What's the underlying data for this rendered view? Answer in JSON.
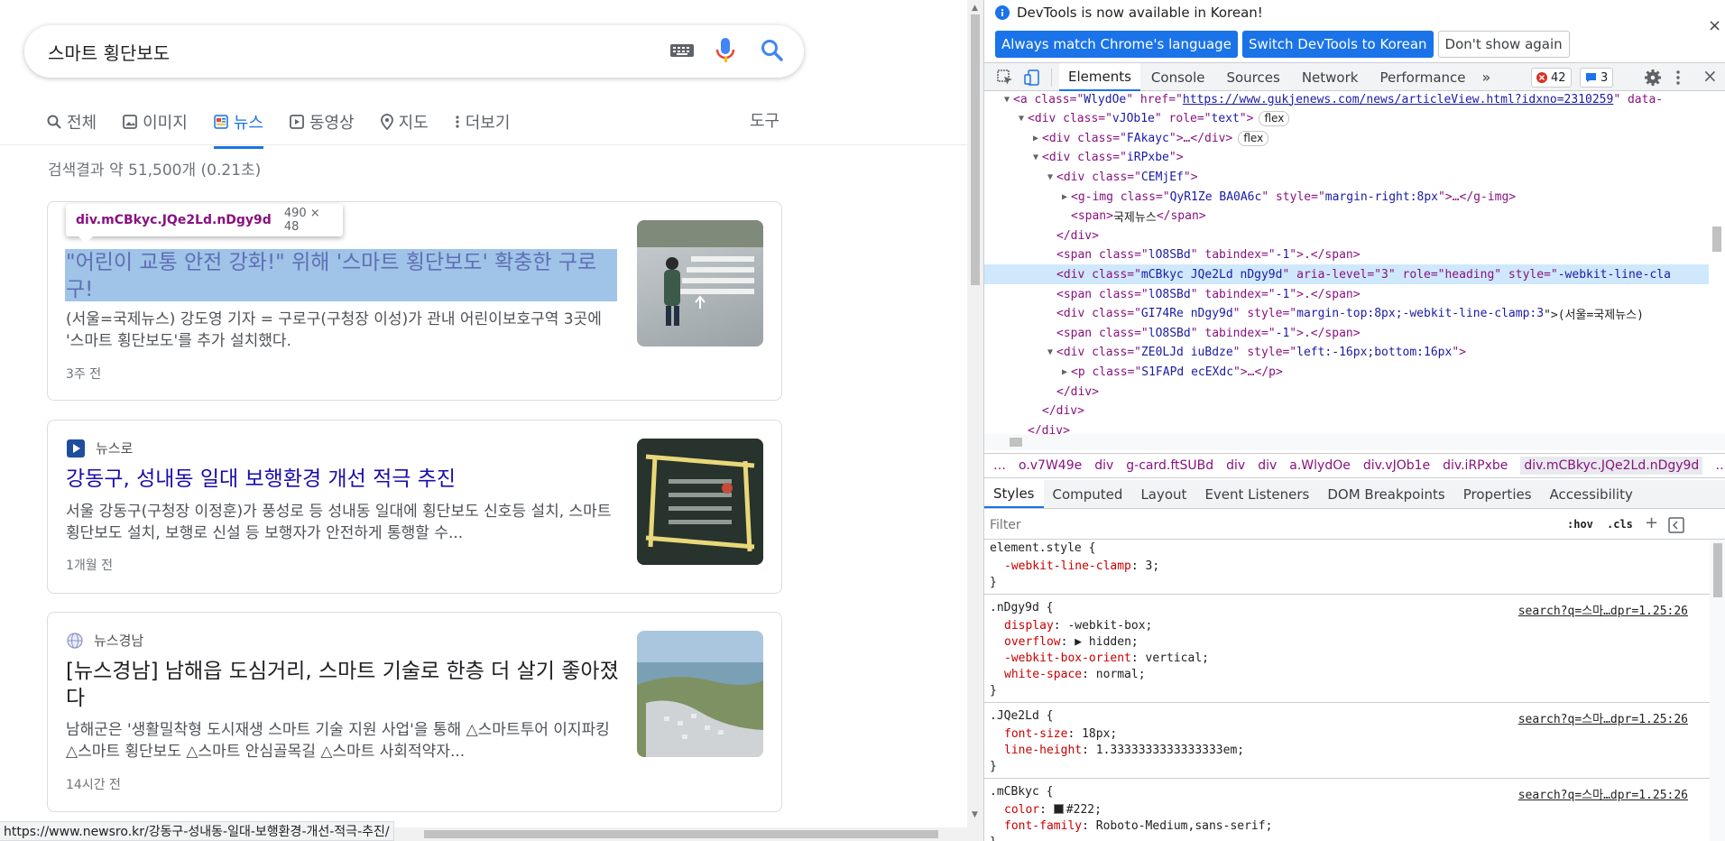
{
  "search": {
    "query": "스마트 횡단보도"
  },
  "tabs": [
    {
      "label": "전체",
      "icon": "search-icon"
    },
    {
      "label": "이미지",
      "icon": "image-icon"
    },
    {
      "label": "뉴스",
      "icon": "news-icon"
    },
    {
      "label": "동영상",
      "icon": "video-icon"
    },
    {
      "label": "지도",
      "icon": "map-pin-icon"
    },
    {
      "label": "더보기",
      "icon": "more-vert-icon"
    }
  ],
  "tools_label": "도구",
  "result_count": "검색결과 약 51,500개 (0.21초)",
  "tooltip": {
    "selector": "div.mCBkyc.JQe2Ld.nDgy9d",
    "size": "490 × 48"
  },
  "results": [
    {
      "source": "",
      "title": "\"어린이 교통 안전 강화!\" 위해 '스마트 횡단보도' 확충한 구로구!",
      "snippet": "(서울=국제뉴스) 강도영 기자 = 구로구(구청장 이성)가 관내 어린이보호구역 3곳에 '스마트 횡단보도'를 추가 설치했다.",
      "age": "3주 전"
    },
    {
      "source": "뉴스로",
      "title": "강동구, 성내동 일대 보행환경 개선 적극 추진",
      "snippet": "서울 강동구(구청장 이정훈)가 풍성로 등 성내동 일대에 횡단보도 신호등 설치, 스마트횡단보도 설치, 보행로 신설 등 보행자가 안전하게 통행할 수...",
      "age": "1개월 전"
    },
    {
      "source": "뉴스경남",
      "title": "[뉴스경남] 남해읍 도심거리, 스마트 기술로 한층 더 살기 좋아졌다",
      "snippet": "남해군은 '생활밀착형 도시재생 스마트 기술 지원 사업'을 통해 △스마트투어 이지파킹 △스마트 횡단보도 △스마트 안심골목길 △스마트 사회적약자...",
      "age": "14시간 전"
    }
  ],
  "status_url": "https://www.newsro.kr/강동구-성내동-일대-보행환경-개선-적극-추진/",
  "devtools": {
    "info_text": "DevTools is now available in Korean!",
    "btn_match": "Always match Chrome's language",
    "btn_switch": "Switch DevTools to Korean",
    "btn_dont": "Don't show again",
    "tabs": [
      "Elements",
      "Console",
      "Sources",
      "Network",
      "Performance"
    ],
    "errors": "42",
    "messages": "3",
    "dom": [
      {
        "a": "<a class=\"",
        "b": "WlydOe",
        "c": "\" href=\"",
        "d": "https://www.gukjenews.com/news/articleView.html?idxno=2310259",
        "e": "\" data-"
      },
      {
        "a": "<div class=\"",
        "b": "vJOb1e",
        "c": "\" role=\"",
        "d": "text",
        "e": "\">"
      },
      {
        "a": "<div class=\"",
        "b": "FAkayc",
        "c": "\">…</div>",
        "d": "",
        "e": ""
      },
      {
        "a": "<div class=\"",
        "b": "iRPxbe",
        "c": "\">",
        "d": "",
        "e": ""
      },
      {
        "a": "<div class=\"",
        "b": "CEMjEf",
        "c": "\">",
        "d": "",
        "e": ""
      },
      {
        "a": "<g-img class=\"",
        "b": "QyR1Ze BA0A6c",
        "c": "\" style=\"",
        "d": "margin-right:8px",
        "e": "\">…</g-img>"
      },
      {
        "a": "<span>",
        "b": "국제뉴스",
        "c": "</span>",
        "d": "",
        "e": ""
      },
      {
        "a": "</div>",
        "b": "",
        "c": "",
        "d": "",
        "e": ""
      },
      {
        "a": "<span class=\"",
        "b": "lO8SBd",
        "c": "\" tabindex=\"",
        "d": "-1",
        "e": "\">.</span>"
      },
      {
        "a": "<div class=\"",
        "b": "mCBkyc JQe2Ld nDgy9d",
        "c": "\" aria-level=\"3\" role=\"heading\" style=\"",
        "d": "-webkit-line-cla",
        "e": ""
      },
      {
        "a": "<span class=\"",
        "b": "lO8SBd",
        "c": "\" tabindex=\"",
        "d": "-1",
        "e": "\">.</span>"
      },
      {
        "a": "<div class=\"",
        "b": "GI74Re nDgy9d",
        "c": "\" style=\"",
        "d": "margin-top:8px;-webkit-line-clamp:3",
        "e": "\">(서울=국제뉴스)"
      },
      {
        "a": "<span class=\"",
        "b": "lO8SBd",
        "c": "\" tabindex=\"",
        "d": "-1",
        "e": "\">.</span>"
      },
      {
        "a": "<div class=\"",
        "b": "ZE0LJd iuBdze",
        "c": "\" style=\"",
        "d": "left:-16px;bottom:16px",
        "e": "\">"
      },
      {
        "a": "<p class=\"",
        "b": "S1FAPd ecEXdc",
        "c": "\">…</p>",
        "d": "",
        "e": ""
      },
      {
        "a": "</div>",
        "b": "",
        "c": "",
        "d": "",
        "e": ""
      },
      {
        "a": "</div>",
        "b": "",
        "c": "",
        "d": "",
        "e": ""
      },
      {
        "a": "</div>",
        "b": "",
        "c": "",
        "d": "",
        "e": ""
      }
    ],
    "flex_badge": "flex",
    "breadcrumbs": [
      "…",
      "o.v7W49e",
      "div",
      "g-card.ftSUBd",
      "div",
      "div",
      "a.WlydOe",
      "div.vJOb1e",
      "div.iRPxbe",
      "div.mCBkyc.JQe2Ld.nDgy9d",
      "…"
    ],
    "subtabs": [
      "Styles",
      "Computed",
      "Layout",
      "Event Listeners",
      "DOM Breakpoints",
      "Properties",
      "Accessibility"
    ],
    "filter_placeholder": "Filter",
    "hov": ":hov",
    "cls": ".cls",
    "rules": [
      {
        "selector": "element.style {",
        "source": "",
        "props": [
          [
            "-webkit-line-clamp",
            "3;"
          ]
        ]
      },
      {
        "selector": ".nDgy9d {",
        "source": "search?q=스마…dpr=1.25:26",
        "props": [
          [
            "display",
            "-webkit-box;"
          ],
          [
            "overflow",
            "▶ hidden;"
          ],
          [
            "-webkit-box-orient",
            "vertical;"
          ],
          [
            "white-space",
            "normal;"
          ]
        ]
      },
      {
        "selector": ".JQe2Ld {",
        "source": "search?q=스마…dpr=1.25:26",
        "props": [
          [
            "font-size",
            "18px;"
          ],
          [
            "line-height",
            "1.3333333333333333em;"
          ]
        ]
      },
      {
        "selector": ".mCBkyc {",
        "source": "search?q=스마…dpr=1.25:26",
        "props": [
          [
            "color",
            "#222;"
          ],
          [
            "font-family",
            "Roboto-Medium,sans-serif;"
          ]
        ]
      }
    ],
    "rule_close": "}"
  },
  "colors": {
    "accent": "#1a73e8",
    "link": "#1a0dab",
    "highlight": "#a0c3e8",
    "devtools_blue": "#1a73e8",
    "selected_row": "#cfe8fc"
  }
}
